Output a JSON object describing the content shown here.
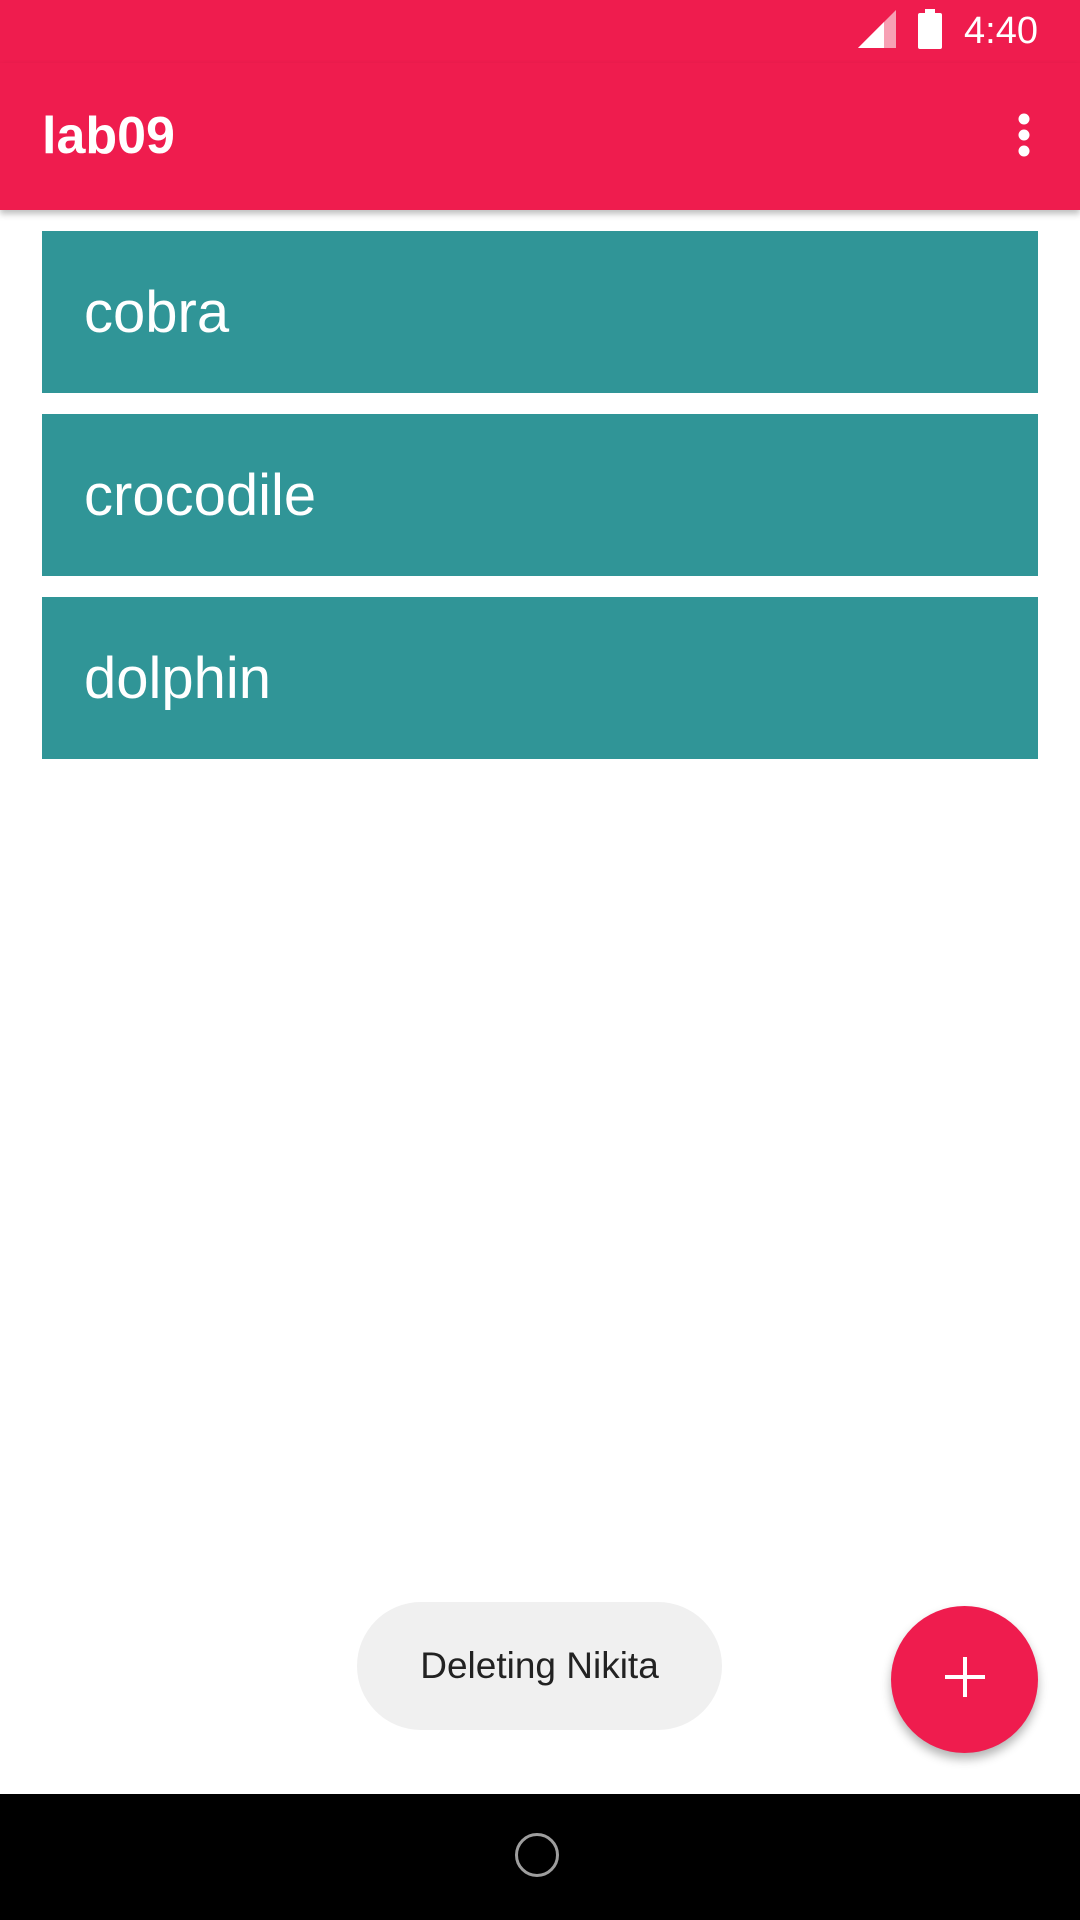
{
  "status_bar": {
    "time": "4:40",
    "icons": [
      "signal-icon",
      "battery-icon"
    ]
  },
  "app_bar": {
    "title": "lab09",
    "menu_icon": "more-vert-icon"
  },
  "list": {
    "items": [
      {
        "label": "cobra"
      },
      {
        "label": "crocodile"
      },
      {
        "label": "dolphin"
      }
    ]
  },
  "toast": {
    "text": "Deleting Nikita"
  },
  "fab": {
    "icon": "plus-icon"
  },
  "nav_bar": {
    "icons": [
      "home-icon"
    ]
  },
  "colors": {
    "primary": "#ef1c4e",
    "list_item_bg": "#309597",
    "toast_bg": "#f0f0f0"
  }
}
